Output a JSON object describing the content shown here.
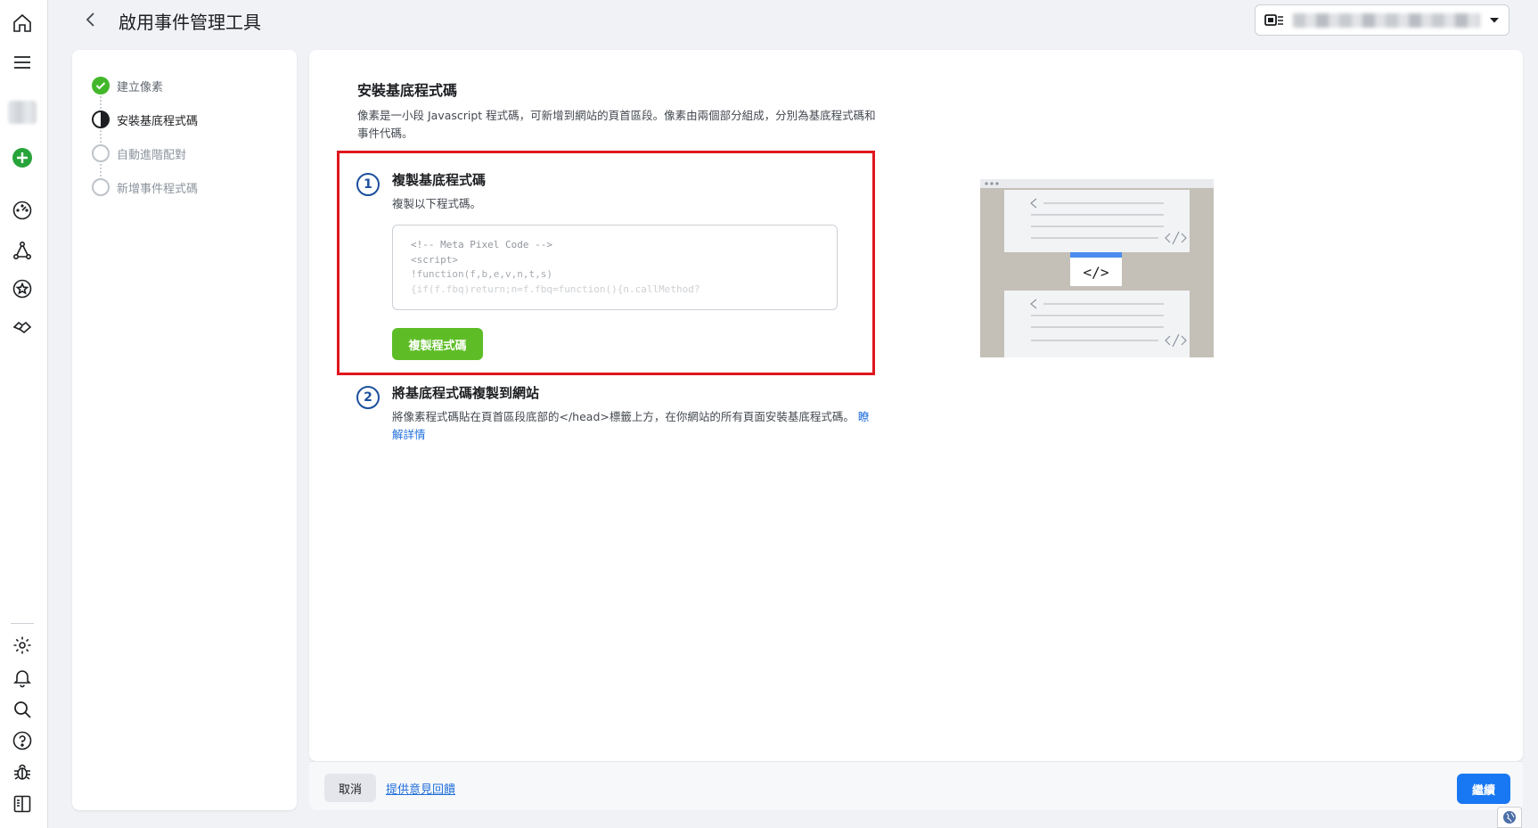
{
  "header": {
    "title": "啟用事件管理工具",
    "account_name": ""
  },
  "steps": [
    {
      "label": "建立像素",
      "state": "complete"
    },
    {
      "label": "安裝基底程式碼",
      "state": "current"
    },
    {
      "label": "自動進階配對",
      "state": "pending"
    },
    {
      "label": "新增事件程式碼",
      "state": "pending"
    }
  ],
  "main": {
    "title": "安裝基底程式碼",
    "description": "像素是一小段 Javascript 程式碼，可新增到網站的頁首區段。像素由兩個部分組成，分別為基底程式碼和事件代碼。",
    "step1": {
      "number": "1",
      "title": "複製基底程式碼",
      "desc": "複製以下程式碼。",
      "code": [
        "<!-- Meta Pixel Code -->",
        "<script>",
        "!function(f,b,e,v,n,t,s)",
        "{if(f.fbq)return;n=f.fbq=function(){n.callMethod?"
      ],
      "copy_button": "複製程式碼"
    },
    "step2": {
      "number": "2",
      "title": "將基底程式碼複製到網站",
      "desc": "將像素程式碼貼在頁首區段底部的</head>標籤上方，在你網站的所有頁面安裝基底程式碼。",
      "link": "瞭解詳情"
    }
  },
  "footer": {
    "cancel": "取消",
    "feedback": "提供意見回饋",
    "continue": "繼續"
  },
  "colors": {
    "accent": "#1877f2",
    "success": "#5ebd26",
    "highlight": "#e0161e",
    "step_check": "#42b72a"
  }
}
